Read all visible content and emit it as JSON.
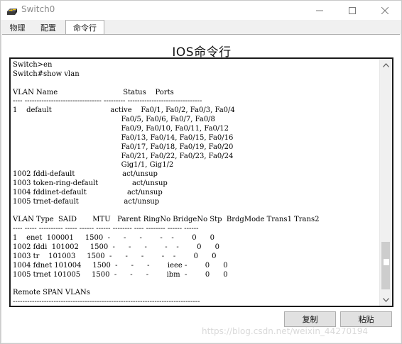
{
  "window": {
    "title": "Switch0",
    "icon": "cisco-switch-icon"
  },
  "tabs": [
    {
      "label": "物理",
      "active": false
    },
    {
      "label": "配置",
      "active": false
    },
    {
      "label": "命令行",
      "active": true
    }
  ],
  "cli": {
    "heading": "IOS命令行",
    "lines": [
      "Switch>en",
      "Switch#show vlan",
      "",
      "VLAN Name                             Status    Ports",
      "---- -------------------------------- --------- -------------------------------",
      "1    default                          active    Fa0/1, Fa0/2, Fa0/3, Fa0/4",
      "                                                Fa0/5, Fa0/6, Fa0/7, Fa0/8",
      "                                                Fa0/9, Fa0/10, Fa0/11, Fa0/12",
      "                                                Fa0/13, Fa0/14, Fa0/15, Fa0/16",
      "                                                Fa0/17, Fa0/18, Fa0/19, Fa0/20",
      "                                                Fa0/21, Fa0/22, Fa0/23, Fa0/24",
      "                                                Gig1/1, Gig1/2",
      "1002 fddi-default                     act/unsup",
      "1003 token-ring-default               act/unsup",
      "1004 fddinet-default                  act/unsup",
      "1005 trnet-default                    act/unsup",
      "",
      "VLAN Type  SAID       MTU   Parent RingNo BridgeNo Stp  BrdgMode Trans1 Trans2",
      "---- ----- ---------- ----- ------ ------ -------- ---- -------- ------ ------",
      "1    enet  100001     1500  -      -      -        -    -        0      0",
      "1002 fddi  101002     1500  -      -      -        -    -        0      0",
      "1003 tr    101003     1500  -      -      -        -    -        0      0",
      "1004 fdnet 101004     1500  -      -      -        ieee -        0      0",
      "1005 trnet 101005     1500  -      -      -        ibm  -        0      0",
      "",
      "Remote SPAN VLANs",
      "------------------------------------------------------------------------------"
    ]
  },
  "buttons": {
    "copy": "复制",
    "paste": "粘贴"
  },
  "watermark": "https://blog.csdn.net/weixin_44270194",
  "colors": {
    "title_text": "#8a8a8a",
    "button_bg": "#e1e1e1",
    "terminal_border": "#1a1a1a"
  }
}
